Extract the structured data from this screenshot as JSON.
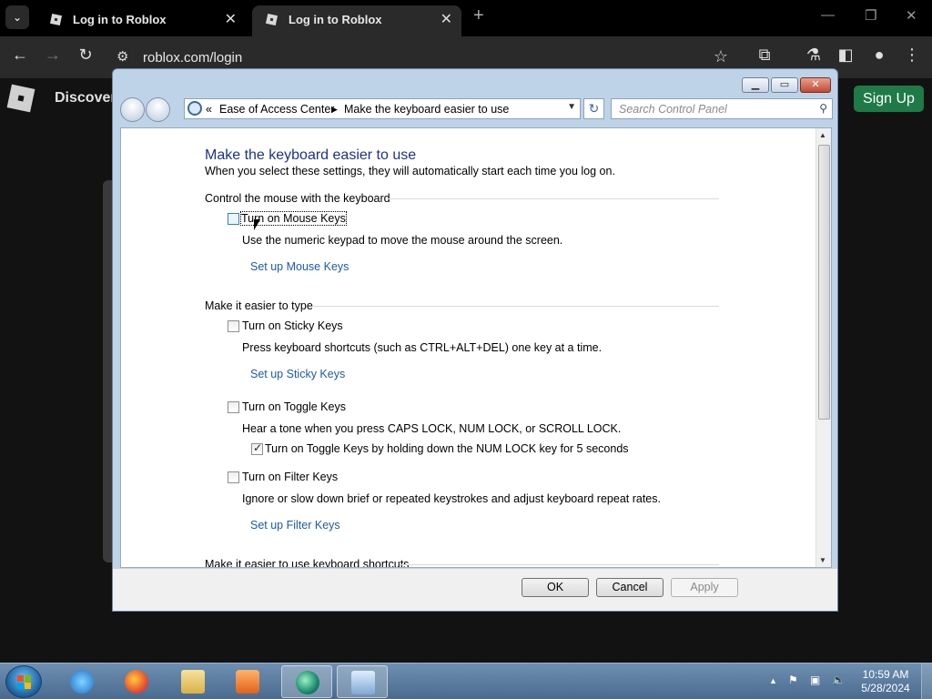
{
  "browser": {
    "tabs": [
      {
        "title": "Log in to Roblox"
      },
      {
        "title": "Log in to Roblox"
      }
    ],
    "url": "roblox.com/login"
  },
  "roblox": {
    "nav_discover": "Discover",
    "signup_label": "Sign Up"
  },
  "cpwindow": {
    "breadcrumb_prefix": "«",
    "breadcrumb": [
      "Ease of Access Center",
      "Make the keyboard easier to use"
    ],
    "search_placeholder": "Search Control Panel",
    "heading": "Make the keyboard easier to use",
    "intro": "When you select these settings, they will automatically start each time you log on.",
    "sections": {
      "mouse": {
        "title": "Control the mouse with the keyboard",
        "option": "Turn on Mouse Keys",
        "checked": false,
        "description": "Use the numeric keypad to move the mouse around the screen.",
        "link": "Set up Mouse Keys"
      },
      "type": {
        "title": "Make it easier to type",
        "sticky": {
          "option": "Turn on Sticky Keys",
          "checked": false,
          "description": "Press keyboard shortcuts (such as CTRL+ALT+DEL) one key at a time.",
          "link": "Set up Sticky Keys"
        },
        "toggle": {
          "option": "Turn on Toggle Keys",
          "checked": false,
          "description": "Hear a tone when you press CAPS LOCK, NUM LOCK, or SCROLL LOCK.",
          "suboption": "Turn on Toggle Keys by holding down the NUM LOCK key for 5 seconds",
          "suboption_checked": true
        },
        "filter": {
          "option": "Turn on Filter Keys",
          "checked": false,
          "description": "Ignore or slow down brief or repeated keystrokes and adjust keyboard repeat rates.",
          "link": "Set up Filter Keys"
        }
      },
      "shortcuts": {
        "title": "Make it easier to use keyboard shortcuts"
      }
    },
    "buttons": {
      "ok": "OK",
      "cancel": "Cancel",
      "apply": "Apply"
    }
  },
  "taskbar": {
    "time": "10:59 AM",
    "date": "5/28/2024",
    "apps": [
      "internet-explorer-icon",
      "firefox-icon",
      "explorer-folder-icon",
      "media-player-icon",
      "browser-app-icon",
      "control-panel-icon"
    ]
  }
}
